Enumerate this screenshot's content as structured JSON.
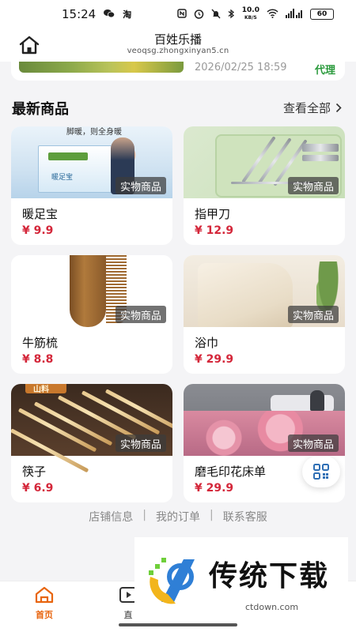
{
  "status_bar": {
    "time": "15:24",
    "network_speed": "10.0",
    "network_unit": "KB/S",
    "battery": "60"
  },
  "header": {
    "title": "百姓乐播",
    "subtitle": "veoqsg.zhongxinyan5.cn"
  },
  "top_card": {
    "date": "2026/02/25 18:59",
    "tag": "代理"
  },
  "section": {
    "title": "最新商品",
    "view_all": "查看全部"
  },
  "products": [
    {
      "name": "暖足宝",
      "price": "¥ 9.9",
      "badge": "实物商品",
      "image": "foot-warmer-box"
    },
    {
      "name": "指甲刀",
      "price": "¥ 12.9",
      "badge": "实物商品",
      "image": "nail-clipper-set"
    },
    {
      "name": "牛筋梳",
      "price": "¥ 8.8",
      "badge": "实物商品",
      "image": "wooden-comb"
    },
    {
      "name": "浴巾",
      "price": "¥ 29.9",
      "badge": "实物商品",
      "image": "bath-towel"
    },
    {
      "name": "筷子",
      "price": "¥ 6.9",
      "badge": "实物商品",
      "image": "chopsticks"
    },
    {
      "name": "磨毛印花床单",
      "price": "¥ 29.9",
      "badge": "实物商品",
      "image": "floral-bedsheet"
    }
  ],
  "thumb_texts": {
    "warmer_top": "脚暖，则全身暖",
    "warmer_label": "暖足宝",
    "chopstick_sign": "山料"
  },
  "footer_links": [
    "店铺信息",
    "我的订单",
    "联系客服"
  ],
  "footer_sep": "|",
  "tabbar": {
    "items": [
      {
        "label": "首页",
        "active": true,
        "icon": "home-icon"
      },
      {
        "label": "直",
        "active": false,
        "icon": "live-icon"
      }
    ]
  },
  "watermark": {
    "text": "传统下载",
    "url": "ctdown.com"
  },
  "colors": {
    "accent": "#e8650f",
    "price": "#d4273a",
    "tag_green": "#2a9a3c"
  }
}
